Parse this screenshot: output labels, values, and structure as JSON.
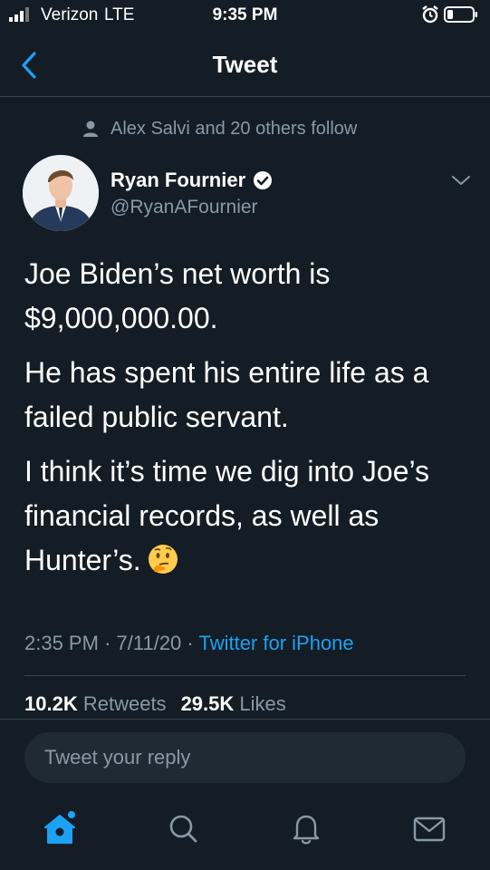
{
  "status_bar": {
    "carrier": "Verizon",
    "network": "LTE",
    "time": "9:35 PM",
    "icons": [
      "signal-icon",
      "alarm-icon",
      "battery-icon"
    ]
  },
  "nav": {
    "title": "Tweet",
    "back_icon": "chevron-left-icon"
  },
  "social_context": {
    "icon": "person-icon",
    "text": "Alex Salvi and 20 others follow"
  },
  "author": {
    "name": "Ryan Fournier",
    "handle": "@RyanAFournier",
    "verified": true
  },
  "tweet": {
    "paragraphs": [
      "Joe Biden’s net worth is $9,000,000.00.",
      "He has spent his entire life as a failed public servant.",
      "I think it’s time we dig into Joe’s financial records, as well as Hunter’s."
    ],
    "emoji": "thinking-face-emoji"
  },
  "meta": {
    "time": "2:35 PM",
    "date": "7/11/20",
    "separator": "·",
    "source": "Twitter for iPhone"
  },
  "stats": {
    "retweets_count": "10.2K",
    "retweets_label": "Retweets",
    "likes_count": "29.5K",
    "likes_label": "Likes"
  },
  "reply": {
    "placeholder": "Tweet your reply"
  },
  "tabs": [
    {
      "name": "home",
      "icon": "home-icon",
      "active": true
    },
    {
      "name": "search",
      "icon": "search-icon",
      "active": false
    },
    {
      "name": "notifications",
      "icon": "bell-icon",
      "active": false
    },
    {
      "name": "messages",
      "icon": "envelope-icon",
      "active": false
    }
  ],
  "colors": {
    "background": "#141d26",
    "accent": "#1da1f2",
    "secondary_text": "#8899a6",
    "divider": "#38444d"
  }
}
